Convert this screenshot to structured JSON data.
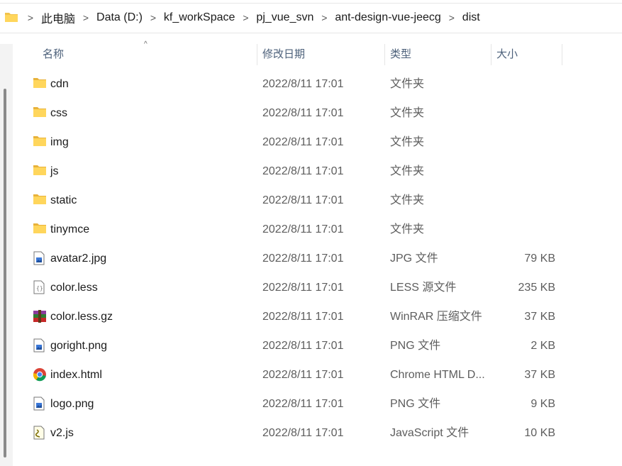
{
  "breadcrumb": {
    "separator": ">",
    "items": [
      "此电脑",
      "Data (D:)",
      "kf_workSpace",
      "pj_vue_svn",
      "ant-design-vue-jeecg",
      "dist"
    ]
  },
  "columns": {
    "name": "名称",
    "modified": "修改日期",
    "type": "类型",
    "size": "大小",
    "sort_indicator": "^"
  },
  "files": [
    {
      "name": "cdn",
      "modified": "2022/8/11 17:01",
      "type": "文件夹",
      "size": "",
      "icon": "folder-icon"
    },
    {
      "name": "css",
      "modified": "2022/8/11 17:01",
      "type": "文件夹",
      "size": "",
      "icon": "folder-icon"
    },
    {
      "name": "img",
      "modified": "2022/8/11 17:01",
      "type": "文件夹",
      "size": "",
      "icon": "folder-icon"
    },
    {
      "name": "js",
      "modified": "2022/8/11 17:01",
      "type": "文件夹",
      "size": "",
      "icon": "folder-icon"
    },
    {
      "name": "static",
      "modified": "2022/8/11 17:01",
      "type": "文件夹",
      "size": "",
      "icon": "folder-icon"
    },
    {
      "name": "tinymce",
      "modified": "2022/8/11 17:01",
      "type": "文件夹",
      "size": "",
      "icon": "folder-icon"
    },
    {
      "name": "avatar2.jpg",
      "modified": "2022/8/11 17:01",
      "type": "JPG 文件",
      "size": "79 KB",
      "icon": "image-file-icon"
    },
    {
      "name": "color.less",
      "modified": "2022/8/11 17:01",
      "type": "LESS 源文件",
      "size": "235 KB",
      "icon": "code-file-icon"
    },
    {
      "name": "color.less.gz",
      "modified": "2022/8/11 17:01",
      "type": "WinRAR 压缩文件",
      "size": "37 KB",
      "icon": "winrar-icon"
    },
    {
      "name": "goright.png",
      "modified": "2022/8/11 17:01",
      "type": "PNG 文件",
      "size": "2 KB",
      "icon": "image-file-icon"
    },
    {
      "name": "index.html",
      "modified": "2022/8/11 17:01",
      "type": "Chrome HTML D...",
      "size": "37 KB",
      "icon": "chrome-icon"
    },
    {
      "name": "logo.png",
      "modified": "2022/8/11 17:01",
      "type": "PNG 文件",
      "size": "9 KB",
      "icon": "image-file-icon"
    },
    {
      "name": "v2.js",
      "modified": "2022/8/11 17:01",
      "type": "JavaScript 文件",
      "size": "10 KB",
      "icon": "script-file-icon"
    }
  ]
}
